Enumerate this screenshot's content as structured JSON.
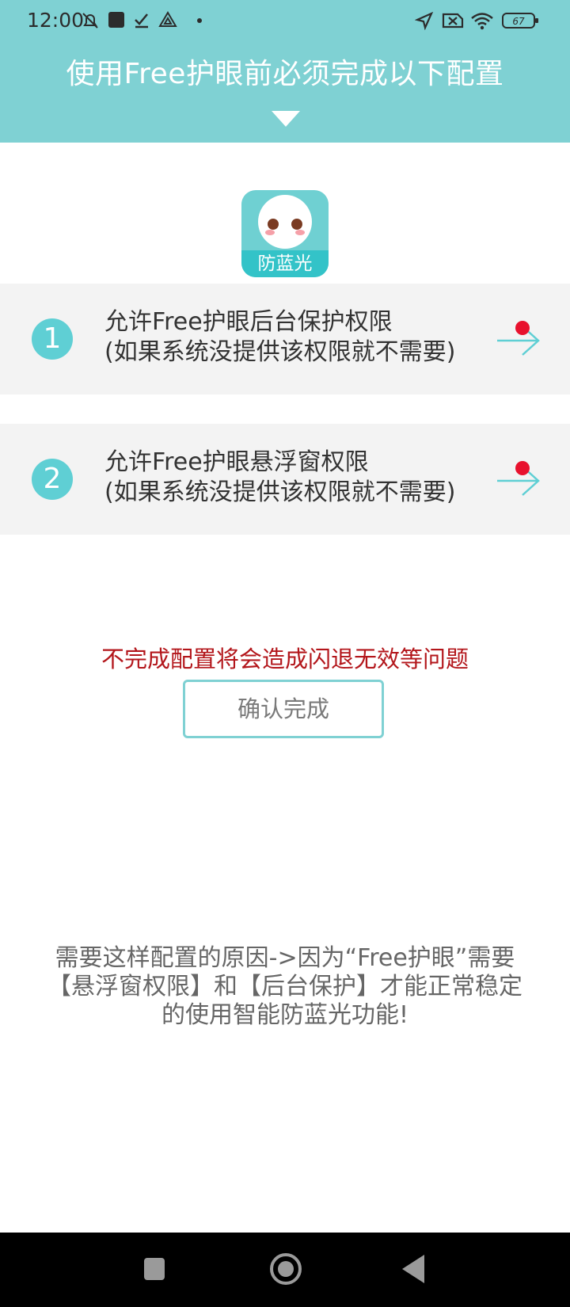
{
  "status_bar": {
    "time": "12:00",
    "battery": "67",
    "icons": [
      "mute-icon",
      "app-square-icon",
      "check-icon",
      "drive-icon",
      "dot-icon",
      "location-icon",
      "sim-x-icon",
      "wifi-icon",
      "battery-icon"
    ]
  },
  "header": {
    "title": "使用Free护眼前必须完成以下配置"
  },
  "app": {
    "logo_label": "防蓝光"
  },
  "permissions": [
    {
      "number": "1",
      "title": "允许Free护眼后台保护权限",
      "note": "(如果系统没提供该权限就不需要)"
    },
    {
      "number": "2",
      "title": "允许Free护眼悬浮窗权限",
      "note": "(如果系统没提供该权限就不需要)"
    }
  ],
  "warning": "不完成配置将会造成闪退无效等问题",
  "confirm_button": "确认完成",
  "reason": {
    "line1": "需要这样配置的原因->因为“Free护眼”需要",
    "line2": "【悬浮窗权限】和【后台保护】才能正常稳定",
    "line3": "的使用智能防蓝光功能!"
  },
  "colors": {
    "header_bg": "#7fd1d3",
    "accent": "#5fcfd4",
    "warning": "#b3161b",
    "badge_dot": "#e8112d"
  }
}
